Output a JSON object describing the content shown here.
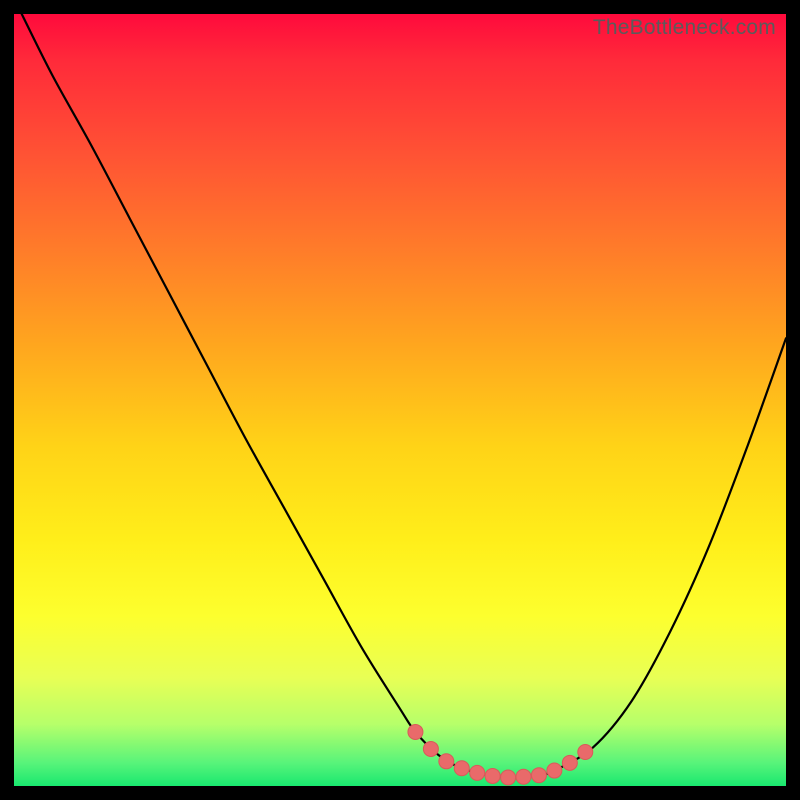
{
  "watermark": {
    "text": "TheBottleneck.com"
  },
  "colors": {
    "page_bg": "#000000",
    "curve": "#000000",
    "marker_fill": "#e96a6a",
    "marker_stroke": "#d95a5a"
  },
  "chart_data": {
    "type": "line",
    "title": "",
    "xlabel": "",
    "ylabel": "",
    "xlim": [
      0,
      100
    ],
    "ylim": [
      0,
      100
    ],
    "grid": false,
    "legend_position": "none",
    "series": [
      {
        "name": "bottleneck-curve",
        "x": [
          1,
          5,
          10,
          15,
          20,
          25,
          30,
          35,
          40,
          45,
          50,
          52,
          55,
          58,
          62,
          65,
          68,
          70,
          75,
          80,
          85,
          90,
          95,
          100
        ],
        "y": [
          100,
          92,
          83,
          73.5,
          64,
          54.5,
          45,
          36,
          27,
          18,
          10,
          7,
          4,
          2.3,
          1.3,
          1.1,
          1.4,
          2,
          5,
          11,
          20,
          31,
          44,
          58
        ]
      }
    ],
    "highlight": {
      "name": "optimal-range",
      "points": [
        {
          "x": 52,
          "y": 7.0
        },
        {
          "x": 54,
          "y": 4.8
        },
        {
          "x": 56,
          "y": 3.2
        },
        {
          "x": 58,
          "y": 2.3
        },
        {
          "x": 60,
          "y": 1.7
        },
        {
          "x": 62,
          "y": 1.3
        },
        {
          "x": 64,
          "y": 1.1
        },
        {
          "x": 66,
          "y": 1.2
        },
        {
          "x": 68,
          "y": 1.4
        },
        {
          "x": 70,
          "y": 2.0
        },
        {
          "x": 72,
          "y": 3.0
        },
        {
          "x": 74,
          "y": 4.4
        }
      ]
    }
  }
}
